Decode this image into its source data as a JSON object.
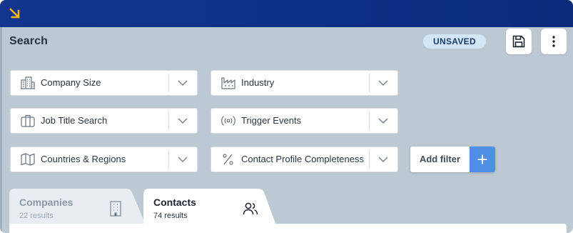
{
  "header": {
    "title": "Search",
    "status_badge": "UNSAVED",
    "corner_icon": "arrow-down-right-icon",
    "actions": [
      {
        "name": "save",
        "icon": "floppy-disk-icon"
      },
      {
        "name": "more",
        "icon": "vertical-dots-icon"
      }
    ]
  },
  "filters": [
    {
      "label": "Company Size",
      "icon": "buildings-icon"
    },
    {
      "label": "Industry",
      "icon": "factory-icon"
    },
    {
      "label": "Job Title Search",
      "icon": "briefcase-icon"
    },
    {
      "label": "Trigger Events",
      "icon": "broadcast-icon"
    },
    {
      "label": "Countries & Regions",
      "icon": "map-icon"
    },
    {
      "label": "Contact Profile Completeness",
      "icon": "percent-icon"
    }
  ],
  "add_filter": {
    "label": "Add filter"
  },
  "tabs": [
    {
      "title": "Companies",
      "subtitle": "22 results",
      "active": false,
      "icon": "building-icon"
    },
    {
      "title": "Contacts",
      "subtitle": "74 results",
      "active": true,
      "icon": "users-icon"
    }
  ],
  "colors": {
    "topbar": "#13358d",
    "accent_yellow": "#f3b313",
    "background": "#bcc8d2",
    "plus_button": "#4f8fe7",
    "badge_bg": "#d2e6f6"
  }
}
